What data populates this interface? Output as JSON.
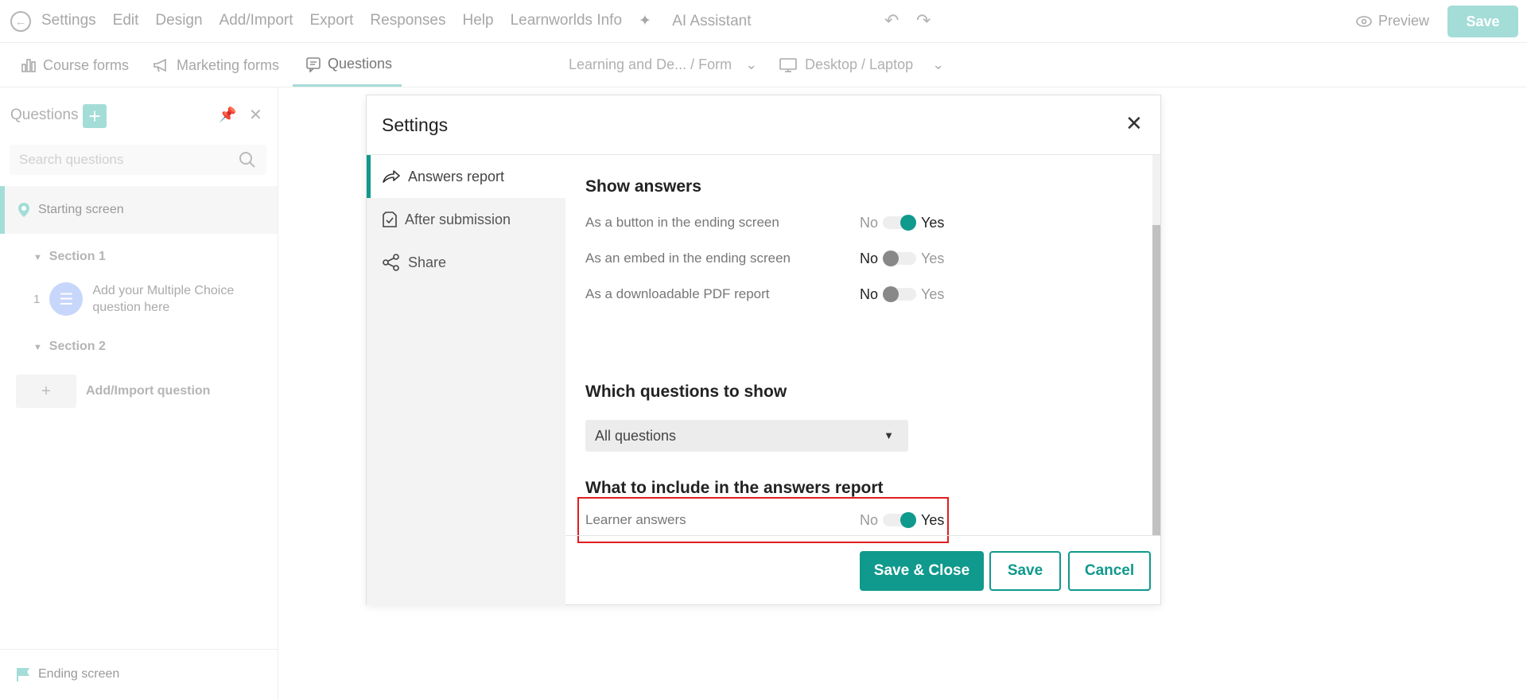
{
  "topbar": {
    "menu": [
      "Settings",
      "Edit",
      "Design",
      "Add/Import",
      "Export",
      "Responses",
      "Help",
      "Learnworlds Info"
    ],
    "ai_assistant": "AI Assistant",
    "preview": "Preview",
    "save": "Save"
  },
  "subbar": {
    "tabs": [
      "Course forms",
      "Marketing forms",
      "Questions"
    ],
    "breadcrumb": "Learning and De... / Form",
    "device": "Desktop / Laptop"
  },
  "sidebar": {
    "title": "Questions",
    "search_placeholder": "Search questions",
    "starting_screen": "Starting screen",
    "section1": "Section 1",
    "question_number": "1",
    "question_text": "Add your Multiple Choice question here",
    "section2": "Section 2",
    "add_question": "Add/Import question",
    "ending_screen": "Ending screen"
  },
  "modal": {
    "title": "Settings",
    "nav": [
      "Answers report",
      "After submission",
      "Share"
    ],
    "show_answers": {
      "heading": "Show answers",
      "rows": [
        {
          "label": "As a button in the ending screen",
          "no": "No",
          "yes": "Yes",
          "value": true
        },
        {
          "label": "As an embed in the ending screen",
          "no": "No",
          "yes": "Yes",
          "value": false
        },
        {
          "label": "As a downloadable PDF report",
          "no": "No",
          "yes": "Yes",
          "value": false
        }
      ]
    },
    "which_questions": {
      "heading": "Which questions to show",
      "selected": "All questions"
    },
    "include": {
      "heading": "What to include in the answers report",
      "row": {
        "label": "Learner answers",
        "no": "No",
        "yes": "Yes",
        "value": true
      }
    },
    "buttons": {
      "save_close": "Save & Close",
      "save": "Save",
      "cancel": "Cancel"
    }
  },
  "colors": {
    "accent": "#10998d",
    "accent_light": "#a4ddd8",
    "highlight": "#e01e1e",
    "ai": "#c59be3"
  }
}
